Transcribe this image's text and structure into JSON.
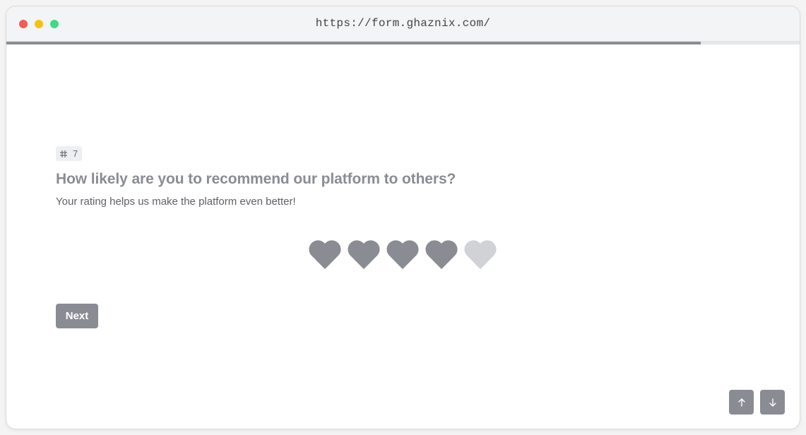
{
  "browser": {
    "url": "https://form.ghaznix.com/",
    "traffic_lights": {
      "red": "#f25c54",
      "yellow": "#f5c211",
      "green": "#3ddc84"
    }
  },
  "progress": {
    "fraction": 0.875,
    "color": "#8a8c94"
  },
  "question": {
    "number_icon": "hash-icon",
    "number": "7",
    "title": "How likely are you to recommend our platform to others?",
    "subtitle": "Your rating helps us make the platform even better!"
  },
  "rating": {
    "icon": "heart-icon",
    "max": 5,
    "value": 4,
    "filled_color": "#8a8c94",
    "empty_color": "#d1d2d6"
  },
  "actions": {
    "next_label": "Next",
    "button_color": "#8a8c94",
    "up_icon": "arrow-up-icon",
    "down_icon": "arrow-down-icon"
  }
}
